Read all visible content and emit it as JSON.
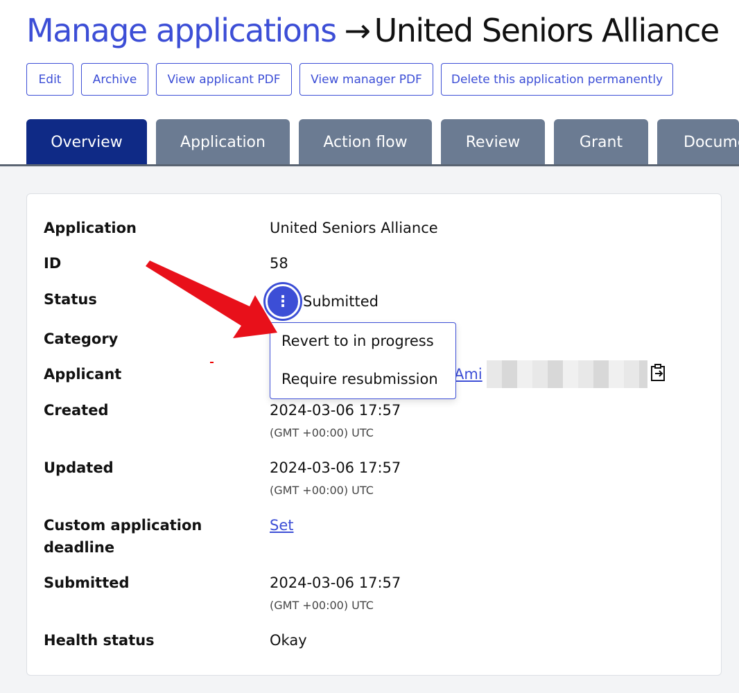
{
  "header": {
    "breadcrumb": "Manage applications",
    "arrow": "→",
    "current": "United Seniors Alliance"
  },
  "actions": [
    {
      "label": "Edit"
    },
    {
      "label": "Archive"
    },
    {
      "label": "View applicant PDF"
    },
    {
      "label": "View manager PDF"
    },
    {
      "label": "Delete this application permanently"
    }
  ],
  "tabs": [
    {
      "label": "Overview",
      "active": true
    },
    {
      "label": "Application"
    },
    {
      "label": "Action flow"
    },
    {
      "label": "Review"
    },
    {
      "label": "Grant"
    },
    {
      "label": "Documents"
    }
  ],
  "details": {
    "application_label": "Application",
    "application_value": "United Seniors Alliance",
    "id_label": "ID",
    "id_value": "58",
    "status_label": "Status",
    "status_value": "Submitted",
    "category_label": "Category",
    "applicant_label": "Applicant",
    "applicant_link": "Ami",
    "created_label": "Created",
    "created_value": "2024-03-06 17:57",
    "created_tz": "(GMT +00:00) UTC",
    "updated_label": "Updated",
    "updated_value": "2024-03-06 17:57",
    "updated_tz": "(GMT +00:00) UTC",
    "deadline_label_1": "Custom application",
    "deadline_label_2": "deadline",
    "deadline_action": "Set",
    "submitted_label": "Submitted",
    "submitted_value": "2024-03-06 17:57",
    "submitted_tz": "(GMT +00:00) UTC",
    "health_label": "Health status",
    "health_value": "Okay"
  },
  "status_menu": {
    "items": [
      {
        "label": "Revert to in progress"
      },
      {
        "label": "Require resubmission"
      }
    ]
  },
  "colors": {
    "accent": "#3c4ed6",
    "active_tab": "#0f2a86",
    "inactive_tab": "#6b7b92",
    "annotation_arrow": "#e8101a"
  }
}
